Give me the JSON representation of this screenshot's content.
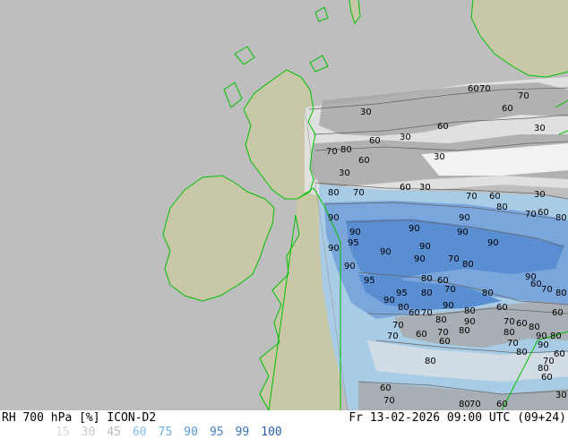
{
  "product": {
    "left_title": "RH 700 hPa [%] ICON-D2",
    "right_title": "Fr 13-02-2026 09:00 UTC (09+24)"
  },
  "legend": {
    "items": [
      {
        "label": "15",
        "color": "#d9d9d9"
      },
      {
        "label": "30",
        "color": "#c9c9c9"
      },
      {
        "label": "45",
        "color": "#b9b9b9"
      },
      {
        "label": "60",
        "color": "#7fc2ea"
      },
      {
        "label": "75",
        "color": "#6eb0e0"
      },
      {
        "label": "90",
        "color": "#5b9ad5"
      },
      {
        "label": "95",
        "color": "#4a86c8"
      },
      {
        "label": "99",
        "color": "#3a72bb"
      },
      {
        "label": "100",
        "color": "#2a5eae"
      }
    ]
  },
  "colors": {
    "background": "#bebebe",
    "land": "#c8c8a8",
    "coastline": "#00c000",
    "contour": "#646464",
    "rh_low": "#e2e2e2",
    "rh_mid": "#a8a8a8",
    "rh_60": "#a8cce6",
    "rh_90": "#7aa6dc",
    "rh_95": "#5a8ed2"
  },
  "contour_labels": [
    "30",
    "60",
    "70",
    "80",
    "90",
    "95"
  ]
}
